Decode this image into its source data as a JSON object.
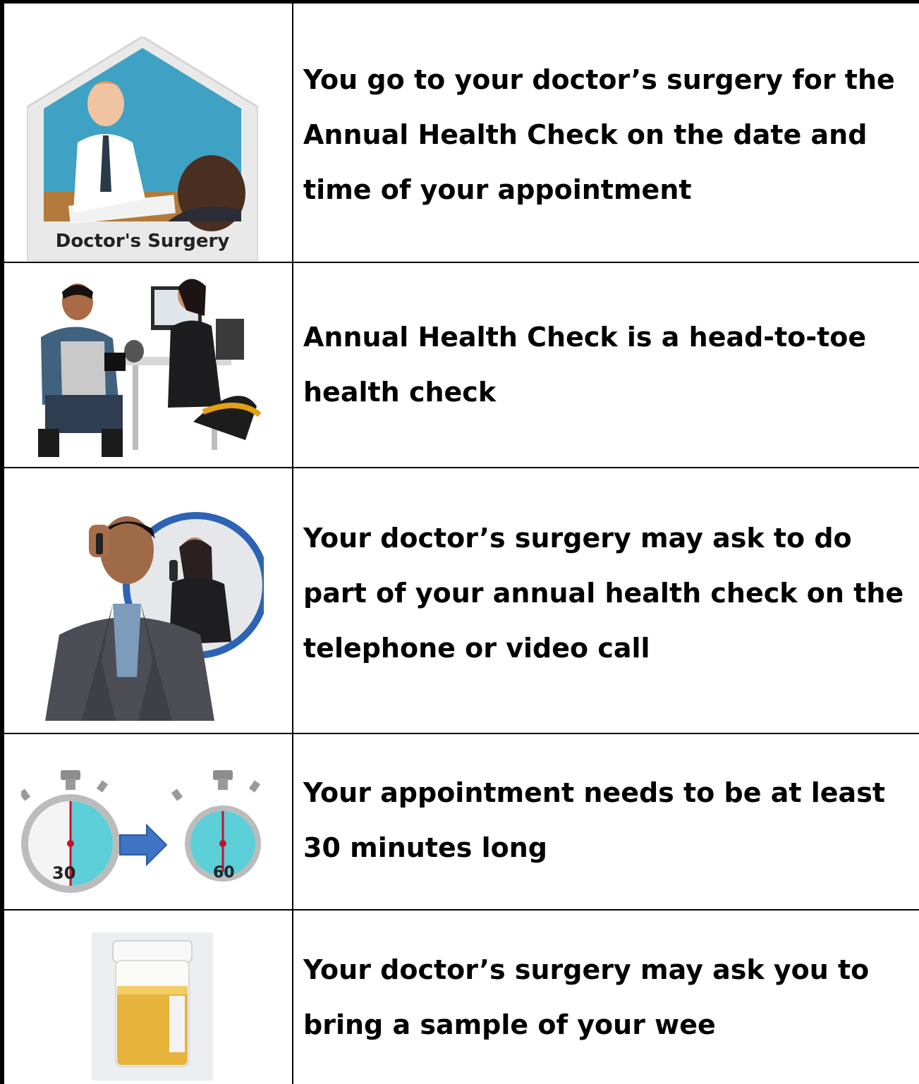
{
  "rows": [
    {
      "image_caption": "Doctor's Surgery",
      "text": "You go to your doctor’s surgery for the Annual Health Check on the date and time of your appointment"
    },
    {
      "text": "Annual Health Check is a head-to-toe health check"
    },
    {
      "text": "Your doctor’s surgery may ask to do part of your annual health check on the telephone or video call"
    },
    {
      "image_labels": {
        "start": "30",
        "end": "60"
      },
      "text": "Your appointment needs to be at least 30 minutes long"
    },
    {
      "text": "Your doctor’s surgery may ask you to bring a sample of your wee"
    }
  ],
  "icons": [
    "doctor-surgery-icon",
    "health-check-blood-pressure-icon",
    "phone-call-icon",
    "stopwatch-30-to-60-icon",
    "urine-sample-icon"
  ]
}
